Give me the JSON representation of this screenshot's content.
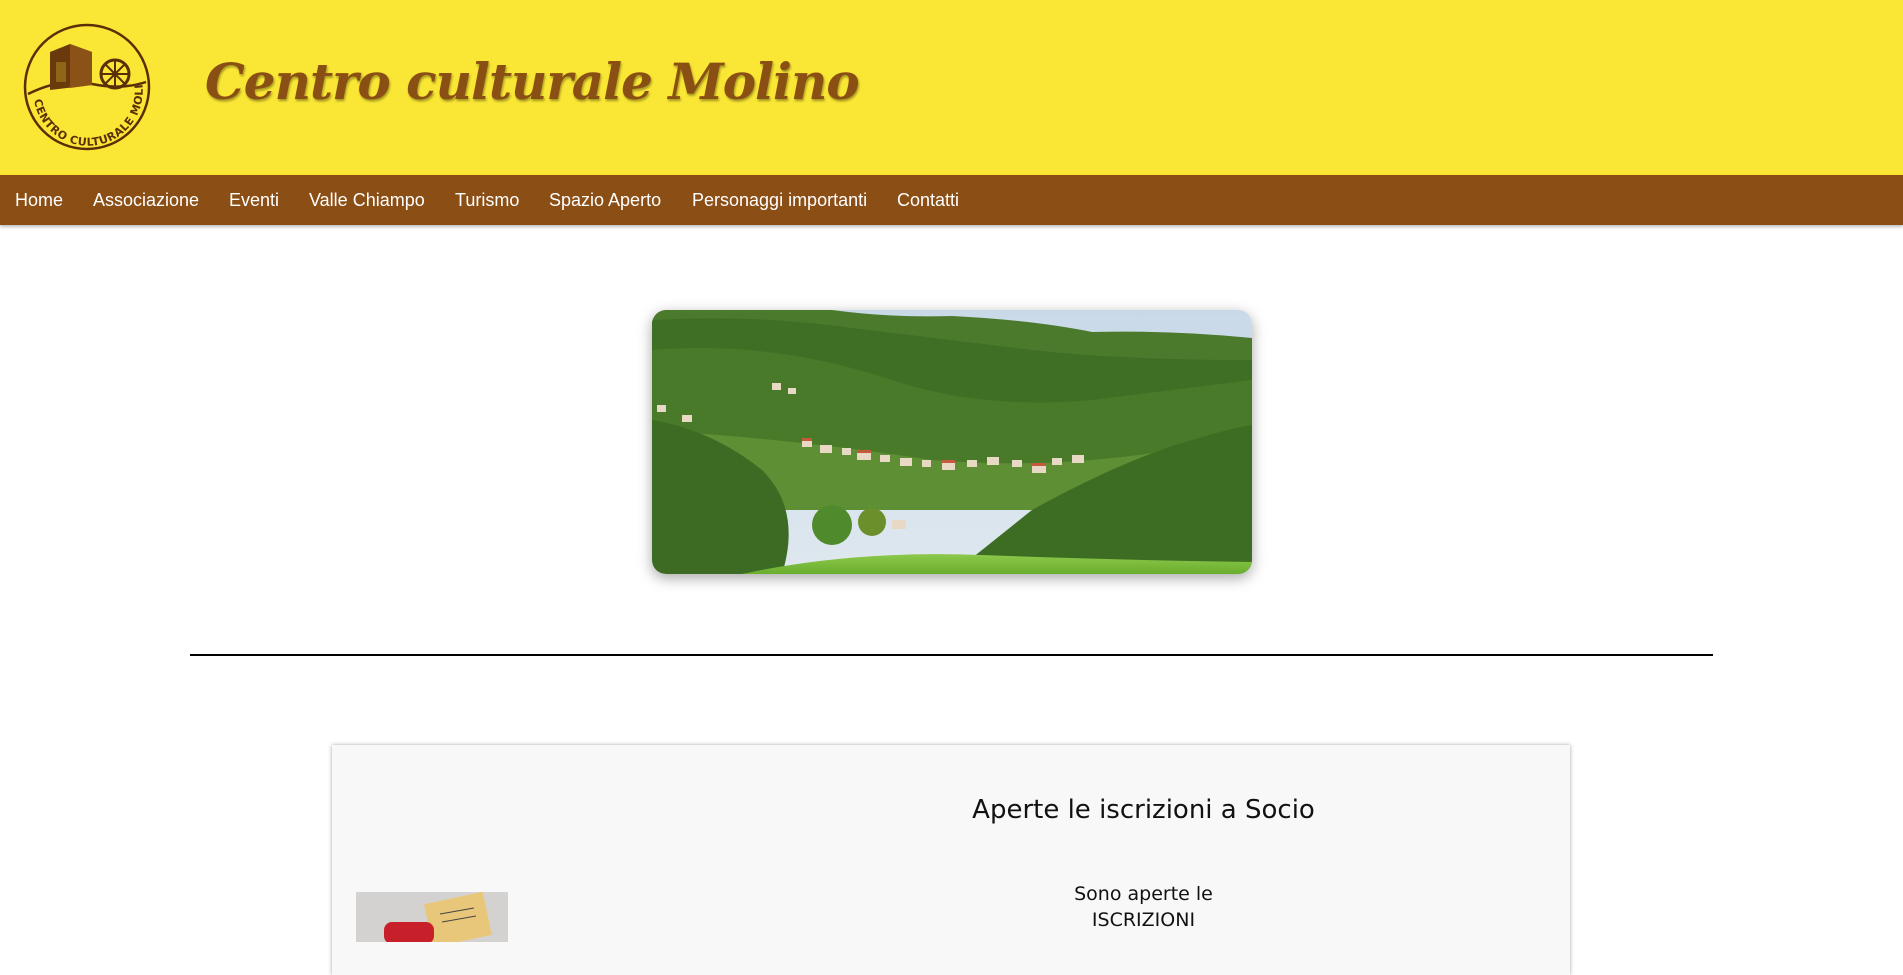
{
  "header": {
    "title": "Centro culturale Molino",
    "logo_text": "CENTRO CULTURALE MOLINO",
    "background": "#fae634",
    "title_color": "#8a4f12"
  },
  "nav": {
    "background": "#8b4e15",
    "items": [
      {
        "label": "Home"
      },
      {
        "label": "Associazione"
      },
      {
        "label": "Eventi"
      },
      {
        "label": "Valle Chiampo"
      },
      {
        "label": "Turismo"
      },
      {
        "label": "Spazio Aperto"
      },
      {
        "label": "Personaggi importanti"
      },
      {
        "label": "Contatti"
      }
    ]
  },
  "hero": {
    "image": "valley-village-landscape"
  },
  "card": {
    "title": "Aperte le iscrizioni a Socio",
    "line1": "Sono aperte le",
    "line2": "ISCRIZIONI",
    "thumb_image": "membership-card-photo"
  }
}
